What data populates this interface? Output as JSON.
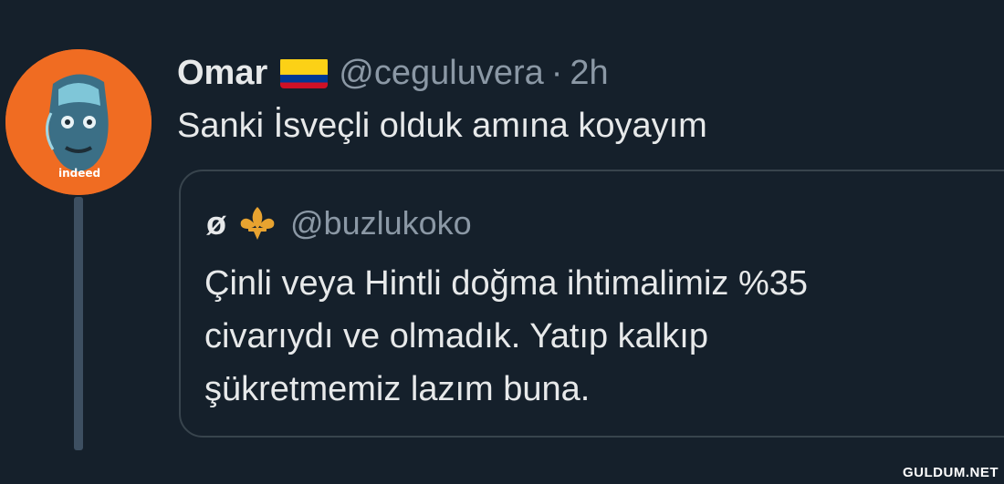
{
  "tweet": {
    "display_name": "Omar",
    "flag_icon": "colombia-flag-icon",
    "handle": "@ceguluvera",
    "separator": "·",
    "time": "2h",
    "text": "Sanki İsveçli olduk amına koyayım",
    "avatar_label": "indeed"
  },
  "quoted_tweet": {
    "display_name": "ø",
    "badge_icon": "fleur-de-lis-icon",
    "handle": "@buzlukoko",
    "text_lines": [
      "Çinli veya Hintli doğma ihtimalimiz %35",
      "civarıydı ve olmadık. Yatıp kalkıp",
      "şükretmemiz lazım buna."
    ]
  },
  "watermark": "GULDUM.NET",
  "colors": {
    "background": "#15202b",
    "avatar_background": "#f06c22",
    "secondary_text": "#8b98a5",
    "border": "#38444d"
  }
}
